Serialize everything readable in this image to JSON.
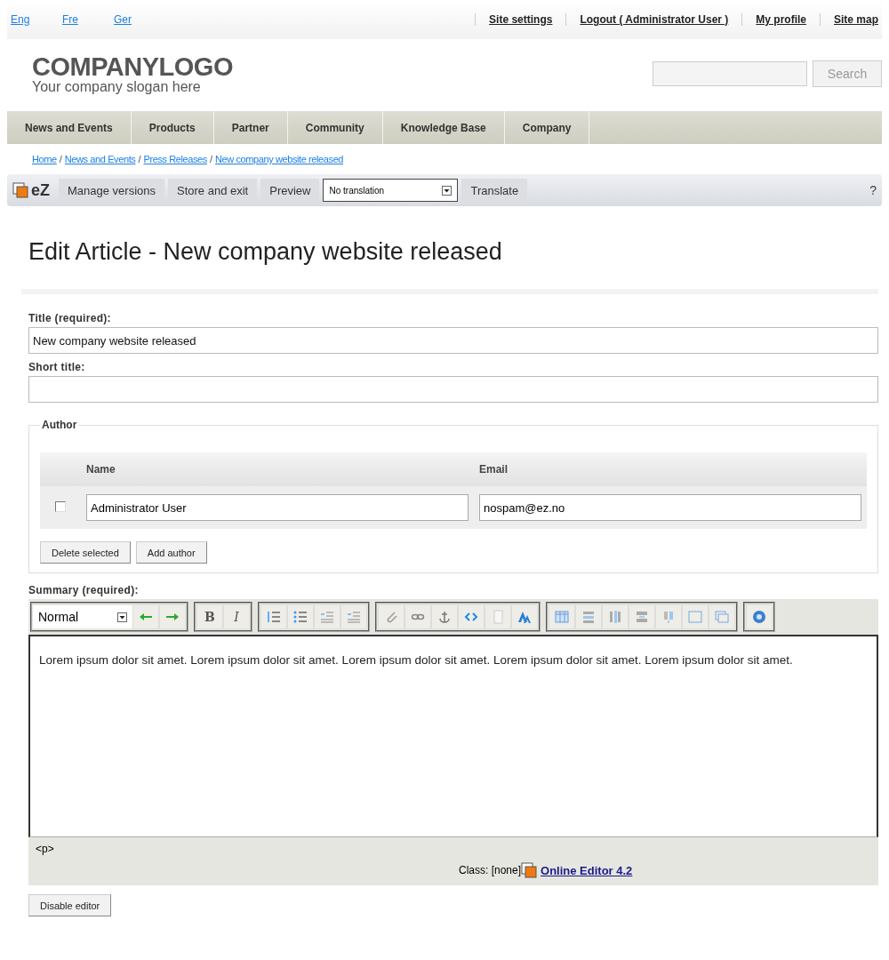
{
  "languages": [
    {
      "label": "Eng"
    },
    {
      "label": "Fre"
    },
    {
      "label": "Ger"
    }
  ],
  "top_links": [
    "Site settings",
    "Logout ( Administrator User )",
    "My profile",
    "Site map"
  ],
  "logo": {
    "title": "COMPANYLOGO",
    "slogan": "Your company slogan here"
  },
  "search": {
    "button": "Search"
  },
  "menu": [
    "News and Events",
    "Products",
    "Partner",
    "Community",
    "Knowledge Base",
    "Company"
  ],
  "breadcrumb": [
    "Home",
    "News and Events",
    "Press Releases",
    "New company website released"
  ],
  "breadcrumb_separator": "/",
  "ez_toolbar": {
    "logo": "eZ",
    "buttons": [
      "Manage versions",
      "Store and exit",
      "Preview"
    ],
    "translation": "No translation",
    "translate": "Translate",
    "help": "?"
  },
  "heading": "Edit Article - New company website released",
  "fields": [
    {
      "label": "Title (required):",
      "value": "New company website released"
    },
    {
      "label": "Short title:"
    }
  ],
  "author": {
    "legend": "Author",
    "columns": [
      "Name",
      "Email"
    ],
    "rows": [
      {
        "checked": false,
        "name": "Administrator User",
        "email": "nospam@ez.no"
      }
    ],
    "buttons": [
      "Delete selected",
      "Add author"
    ]
  },
  "summary": {
    "label": "Summary (required):",
    "format": "Normal",
    "bold": "B",
    "italic": "I",
    "text": "Lorem ipsum dolor sit amet. Lorem ipsum dolor sit amet. Lorem ipsum dolor sit amet. Lorem ipsum dolor sit amet. Lorem ipsum dolor sit amet.",
    "path": "<p>",
    "class_info": "Class: [none]",
    "editor_link": "Online Editor 4.2"
  },
  "disable_button": "Disable editor"
}
